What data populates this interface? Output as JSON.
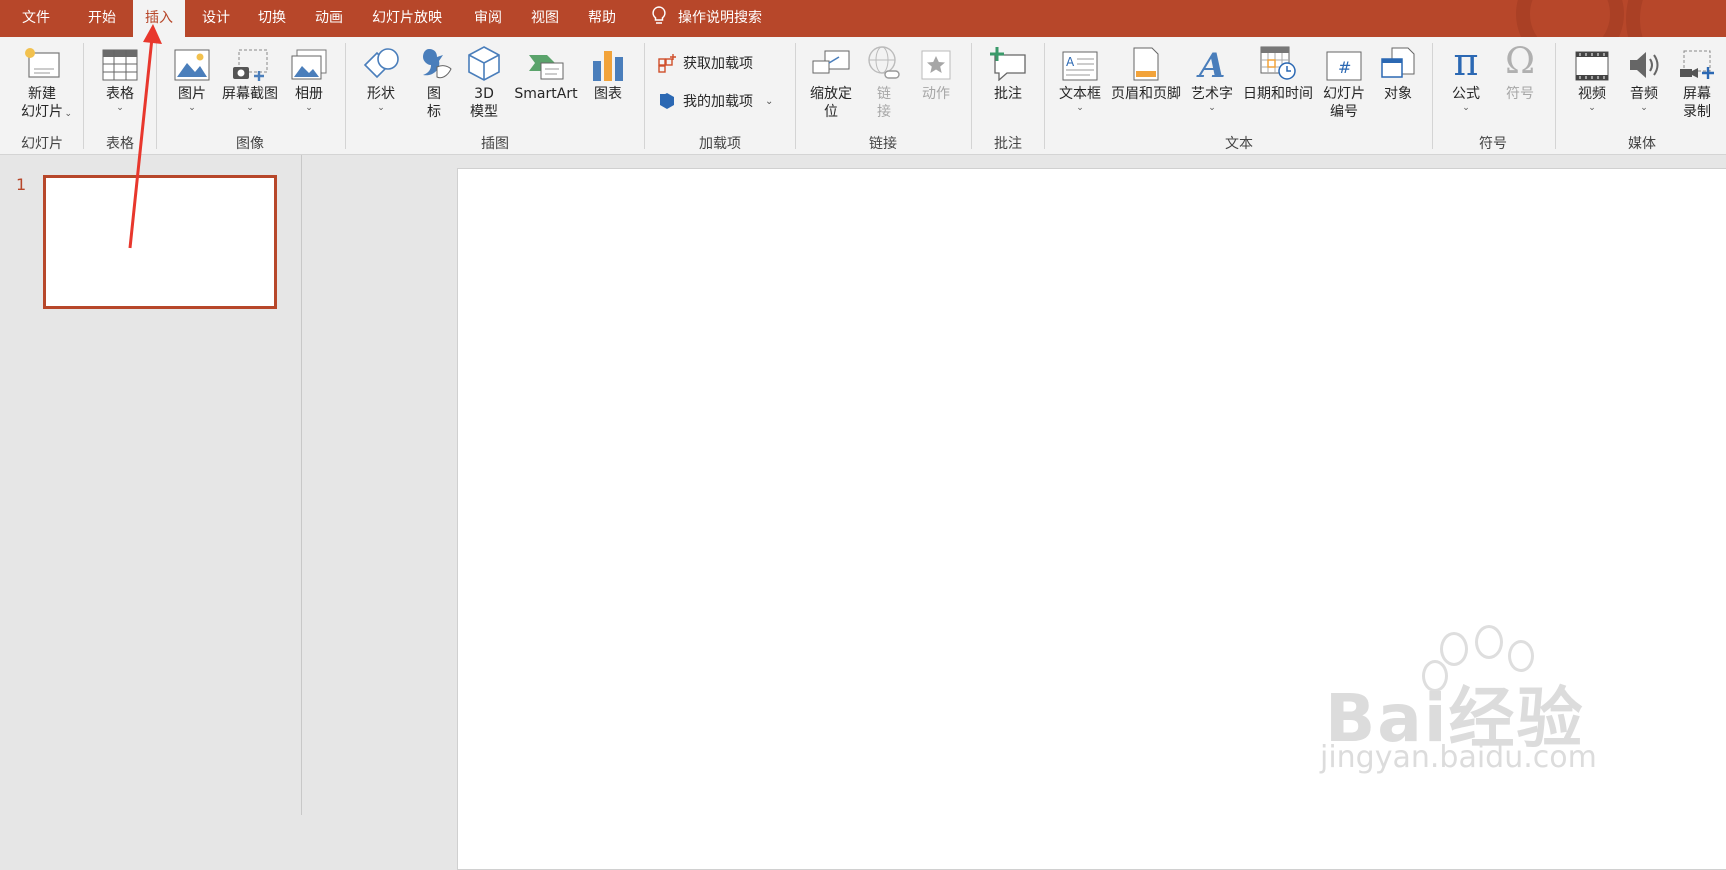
{
  "tabs": {
    "file": "文件",
    "home": "开始",
    "insert": "插入",
    "design": "设计",
    "transitions": "切换",
    "animations": "动画",
    "slideshow": "幻灯片放映",
    "review": "审阅",
    "view": "视图",
    "help": "帮助",
    "tellme": "操作说明搜索"
  },
  "ribbon": {
    "new_slide": "新建\n幻灯片",
    "table": "表格",
    "pictures": "图片",
    "screenshot": "屏幕截图",
    "album": "相册",
    "shapes": "形状",
    "icons": "图\n标",
    "model3d": "3D\n模型",
    "smartart": "SmartArt",
    "chart": "图表",
    "get_addins": "获取加载项",
    "my_addins": "我的加载项",
    "zoom": "缩放定\n位",
    "link": "链\n接",
    "action": "动作",
    "comment": "批注",
    "textbox": "文本框",
    "header_footer": "页眉和页脚",
    "wordart": "艺术字",
    "datetime": "日期和时间",
    "slide_number": "幻灯片\n编号",
    "object": "对象",
    "equation": "公式",
    "symbol": "符号",
    "video": "视频",
    "audio": "音频",
    "screen_record": "屏幕\n录制"
  },
  "groups": {
    "slides": "幻灯片",
    "tables": "表格",
    "images": "图像",
    "illustrations": "插图",
    "addins": "加载项",
    "links": "链接",
    "comments": "批注",
    "text": "文本",
    "symbols": "符号",
    "media": "媒体"
  },
  "thumbnail": {
    "number": "1"
  },
  "watermark": {
    "line1": "Bai经验",
    "line2": "jingyan.baidu.com"
  },
  "colors": {
    "accent": "#b7472a",
    "ribbon_bg": "#f3f3f3",
    "annotation": "#e8372d"
  }
}
